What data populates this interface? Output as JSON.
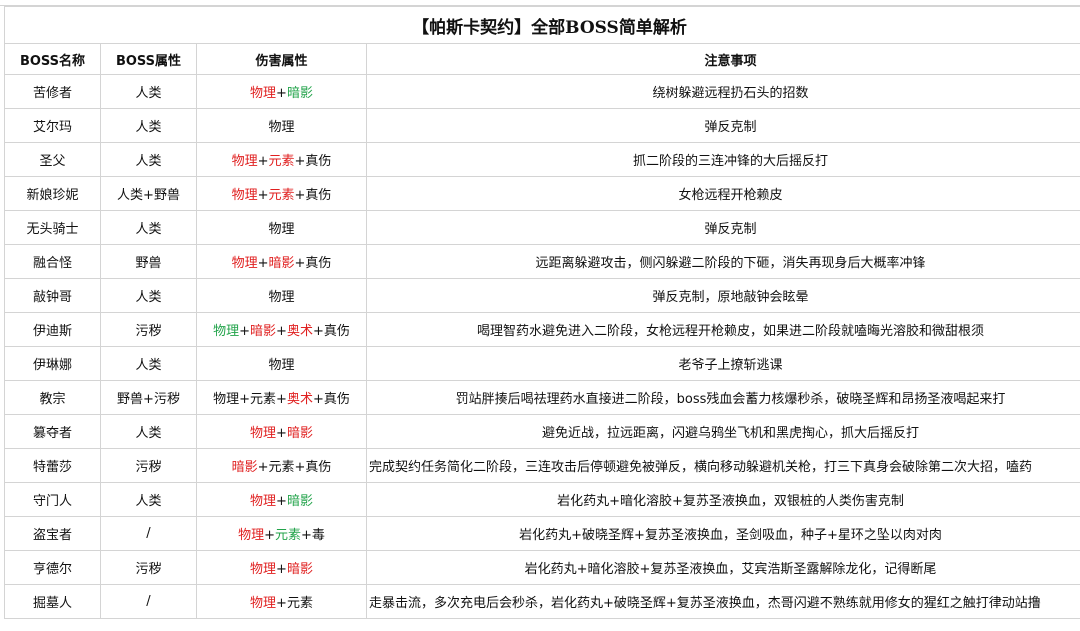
{
  "title": "【帕斯卡契约】全部BOSS简单解析",
  "headers": [
    "BOSS名称",
    "BOSS属性",
    "伤害属性",
    "注意事项"
  ],
  "colors": {
    "red": "#e02020",
    "green": "#22a34a",
    "dark": "#111111"
  },
  "rows": [
    {
      "name": "苦修者",
      "attr": "人类",
      "damage": [
        {
          "t": "物理",
          "c": "red"
        },
        {
          "t": "+",
          "c": "dark"
        },
        {
          "t": "暗影",
          "c": "green"
        }
      ],
      "notes": "绕树躲避远程扔石头的招数"
    },
    {
      "name": "艾尔玛",
      "attr": "人类",
      "damage": [
        {
          "t": "物理",
          "c": "dark"
        }
      ],
      "notes": "弹反克制"
    },
    {
      "name": "圣父",
      "attr": "人类",
      "damage": [
        {
          "t": "物理",
          "c": "red"
        },
        {
          "t": "+",
          "c": "dark"
        },
        {
          "t": "元素",
          "c": "red"
        },
        {
          "t": "+真伤",
          "c": "dark"
        }
      ],
      "notes": "抓二阶段的三连冲锋的大后摇反打"
    },
    {
      "name": "新娘珍妮",
      "attr": "人类+野兽",
      "damage": [
        {
          "t": "物理",
          "c": "red"
        },
        {
          "t": "+",
          "c": "dark"
        },
        {
          "t": "元素",
          "c": "red"
        },
        {
          "t": "+真伤",
          "c": "dark"
        }
      ],
      "notes": "女枪远程开枪赖皮"
    },
    {
      "name": "无头骑士",
      "attr": "人类",
      "damage": [
        {
          "t": "物理",
          "c": "dark"
        }
      ],
      "notes": "弹反克制"
    },
    {
      "name": "融合怪",
      "attr": "野兽",
      "damage": [
        {
          "t": "物理",
          "c": "red"
        },
        {
          "t": "+",
          "c": "dark"
        },
        {
          "t": "暗影",
          "c": "red"
        },
        {
          "t": "+真伤",
          "c": "dark"
        }
      ],
      "notes": "远距离躲避攻击，侧闪躲避二阶段的下砸，消失再现身后大概率冲锋"
    },
    {
      "name": "敲钟哥",
      "attr": "人类",
      "damage": [
        {
          "t": "物理",
          "c": "dark"
        }
      ],
      "notes": "弹反克制，原地敲钟会眩晕"
    },
    {
      "name": "伊迪斯",
      "attr": "污秽",
      "damage": [
        {
          "t": "物理",
          "c": "green"
        },
        {
          "t": "+",
          "c": "dark"
        },
        {
          "t": "暗影",
          "c": "red"
        },
        {
          "t": "+",
          "c": "dark"
        },
        {
          "t": "奥术",
          "c": "red"
        },
        {
          "t": "+真伤",
          "c": "dark"
        }
      ],
      "notes": "喝理智药水避免进入二阶段，女枪远程开枪赖皮，如果进二阶段就嗑晦光溶胶和微甜根须"
    },
    {
      "name": "伊琳娜",
      "attr": "人类",
      "damage": [
        {
          "t": "物理",
          "c": "dark"
        }
      ],
      "notes": "老爷子上撩斩逃课"
    },
    {
      "name": "教宗",
      "attr": "野兽+污秽",
      "damage": [
        {
          "t": "物理+元素+",
          "c": "dark"
        },
        {
          "t": "奥术",
          "c": "red"
        },
        {
          "t": "+真伤",
          "c": "dark"
        }
      ],
      "notes": "罚站胖揍后喝祛理药水直接进二阶段，boss残血会蓄力核爆秒杀，破晓圣辉和昂扬圣液喝起来打"
    },
    {
      "name": "篡夺者",
      "attr": "人类",
      "damage": [
        {
          "t": "物理",
          "c": "red"
        },
        {
          "t": "+",
          "c": "dark"
        },
        {
          "t": "暗影",
          "c": "red"
        }
      ],
      "notes": "避免近战，拉远距离，闪避乌鸦坐飞机和黑虎掏心，抓大后摇反打"
    },
    {
      "name": "特蕾莎",
      "attr": "污秽",
      "damage": [
        {
          "t": "暗影",
          "c": "red"
        },
        {
          "t": "+元素+真伤",
          "c": "dark"
        }
      ],
      "notes": "完成契约任务简化二阶段，三连攻击后停顿避免被弹反，横向移动躲避机关枪，打三下真身会破除第二次大招，嗑药",
      "left": true
    },
    {
      "name": "守门人",
      "attr": "人类",
      "damage": [
        {
          "t": "物理",
          "c": "red"
        },
        {
          "t": "+",
          "c": "dark"
        },
        {
          "t": "暗影",
          "c": "green"
        }
      ],
      "notes": "岩化药丸+暗化溶胶+复苏圣液换血，双银桩的人类伤害克制"
    },
    {
      "name": "盗宝者",
      "attr": "/",
      "damage": [
        {
          "t": "物理",
          "c": "red"
        },
        {
          "t": "+",
          "c": "dark"
        },
        {
          "t": "元素",
          "c": "green"
        },
        {
          "t": "+毒",
          "c": "dark"
        }
      ],
      "notes": "岩化药丸+破晓圣辉+复苏圣液换血，圣剑吸血，种子+星环之坠以肉对肉"
    },
    {
      "name": "亨德尔",
      "attr": "污秽",
      "damage": [
        {
          "t": "物理",
          "c": "red"
        },
        {
          "t": "+",
          "c": "dark"
        },
        {
          "t": "暗影",
          "c": "red"
        }
      ],
      "notes": "岩化药丸+暗化溶胶+复苏圣液换血，艾宾浩斯圣露解除龙化，记得断尾"
    },
    {
      "name": "掘墓人",
      "attr": "/",
      "damage": [
        {
          "t": "物理",
          "c": "red"
        },
        {
          "t": "+元素",
          "c": "dark"
        }
      ],
      "notes": "走暴击流，多次充电后会秒杀，岩化药丸+破晓圣辉+复苏圣液换血，杰哥闪避不熟练就用修女的猩红之触打律动站撸",
      "left": true
    }
  ]
}
